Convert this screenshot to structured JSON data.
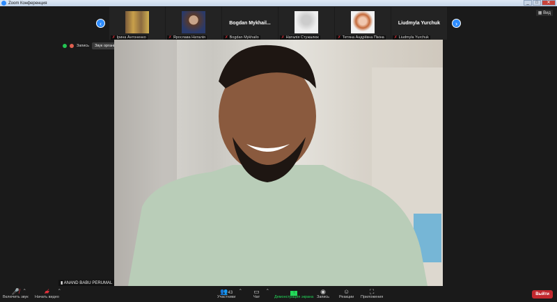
{
  "window": {
    "title": "Zoom Конференция",
    "min": "_",
    "max": "□",
    "close": "✕"
  },
  "participants_strip": [
    {
      "name": "Ірина Антоненко",
      "has_photo": true
    },
    {
      "name": "Ярослава Наталія",
      "has_photo": true
    },
    {
      "name": "Bogdan Mykhailo",
      "display": "Bogdan Mykhail..."
    },
    {
      "name": "Наталія Стужалюк",
      "has_photo": true
    },
    {
      "name": "Тетяна Андріївна Пікіна",
      "has_photo": true
    },
    {
      "name": "Liudmyla Yurchuk",
      "display": "Liudmyla Yurchuk"
    }
  ],
  "status": {
    "recording": "Запись",
    "tooltip": "Звук организатора для пользователя выключен"
  },
  "view_label": "Вид",
  "speaker": {
    "name": "ANAND BABU PERUMAL"
  },
  "toolbar": {
    "unmute": "Включить звук",
    "start_video": "Начать видео",
    "participants": "Участники",
    "participants_count": "43",
    "chat": "Чат",
    "share": "Демонстрация экрана",
    "record": "Запись",
    "reactions": "Реакции",
    "apps": "Приложения",
    "leave": "Выйти"
  },
  "colors": {
    "accent": "#2d8cff",
    "share": "#23d959",
    "leave": "#c2282e"
  }
}
